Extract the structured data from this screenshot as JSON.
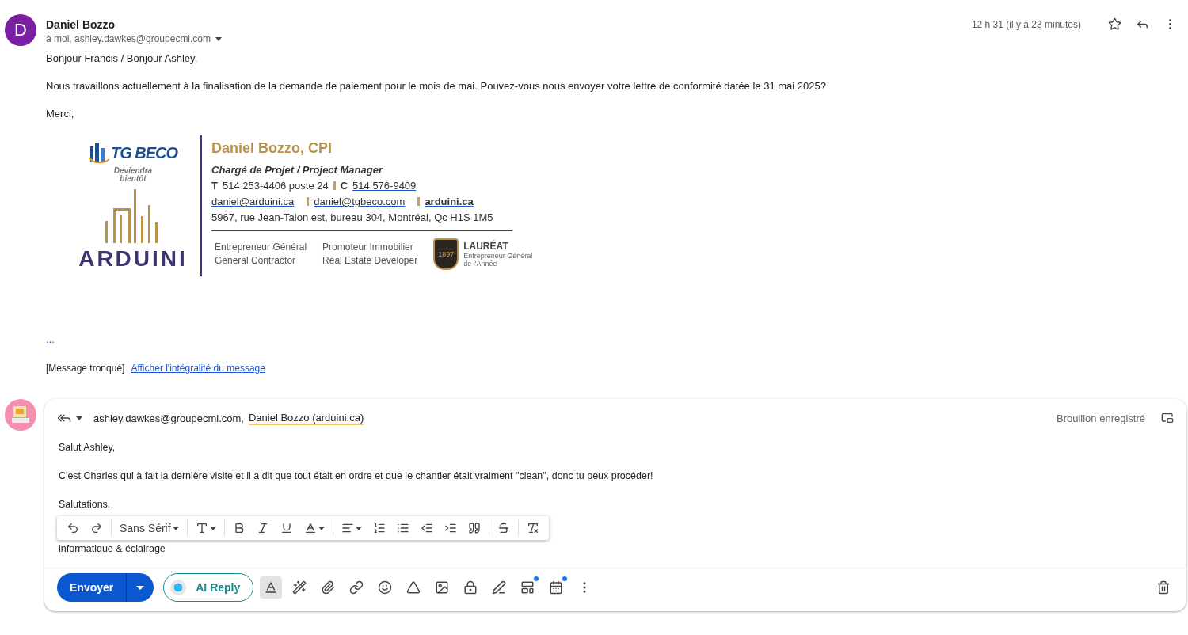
{
  "message": {
    "avatar_letter": "D",
    "sender": "Daniel Bozzo",
    "recipients": "à moi, ashley.dawkes@groupecmi.com",
    "time": "12 h 31 (il y a 23 minutes)",
    "starred": false,
    "paragraphs": [
      "Bonjour Francis / Bonjour Ashley,",
      "Nous travaillons actuellement à la finalisation de la demande de paiement pour le mois de mai. Pouvez-vous nous envoyer votre lettre de conformité datée le 31 mai 2025?",
      "Merci,"
    ],
    "signature": {
      "logo_text": "TG BECO",
      "coming_soon": [
        "Deviendra",
        "bientôt"
      ],
      "brand": "ARDUINI",
      "name": "Daniel Bozzo, CPI",
      "title": "Chargé de Projet / Project Manager",
      "phone_label": "T",
      "phone": "514 253-4406 poste 24",
      "cell_label": "C",
      "cell": "514 576-9409",
      "emails": [
        "daniel@arduini.ca",
        "daniel@tgbeco.com"
      ],
      "website": "arduini.ca",
      "address": "5967, rue Jean-Talon est, bureau 304, Montréal, Qc H1S 1M5",
      "roles": [
        [
          "Entrepreneur Général",
          "General Contractor"
        ],
        [
          "Promoteur Immobilier",
          "Real Estate Developer"
        ]
      ],
      "badge_year": "1897",
      "award_title": "LAURÉAT",
      "award_lines": [
        "Entrepreneur Général",
        "de l'Année"
      ]
    },
    "ellipsis": "...",
    "truncated": "[Message tronqué]",
    "show_full": "Afficher l'intégralité du message"
  },
  "reply": {
    "recipients": "ashley.dawkes@groupecmi.com,",
    "recipient_chip": "Daniel Bozzo (arduini.ca)",
    "status": "Brouillon enregistré",
    "lines": [
      "Salut Ashley,",
      "C'est Charles qui à fait la dernière visite et il a dit que tout était en ordre et que le chantier était vraiment \"clean\", donc tu peux procéder!",
      "Salutations."
    ],
    "font": "Sans Sérif",
    "last_line": "informatique & éclairage",
    "send": "Envoyer",
    "ai_reply": "AI Reply",
    "tools": [
      {
        "kind": "format",
        "active": true,
        "dot": false
      },
      {
        "kind": "write",
        "active": false,
        "dot": false
      },
      {
        "kind": "attach",
        "active": false,
        "dot": false
      },
      {
        "kind": "link",
        "active": false,
        "dot": false
      },
      {
        "kind": "emoji",
        "active": false,
        "dot": false
      },
      {
        "kind": "drive",
        "active": false,
        "dot": false
      },
      {
        "kind": "photo",
        "active": false,
        "dot": false
      },
      {
        "kind": "confidential",
        "active": false,
        "dot": false
      },
      {
        "kind": "signature",
        "active": false,
        "dot": false
      },
      {
        "kind": "template",
        "active": false,
        "dot": true
      },
      {
        "kind": "schedule",
        "active": false,
        "dot": true
      },
      {
        "kind": "more",
        "active": false,
        "dot": false
      }
    ]
  }
}
